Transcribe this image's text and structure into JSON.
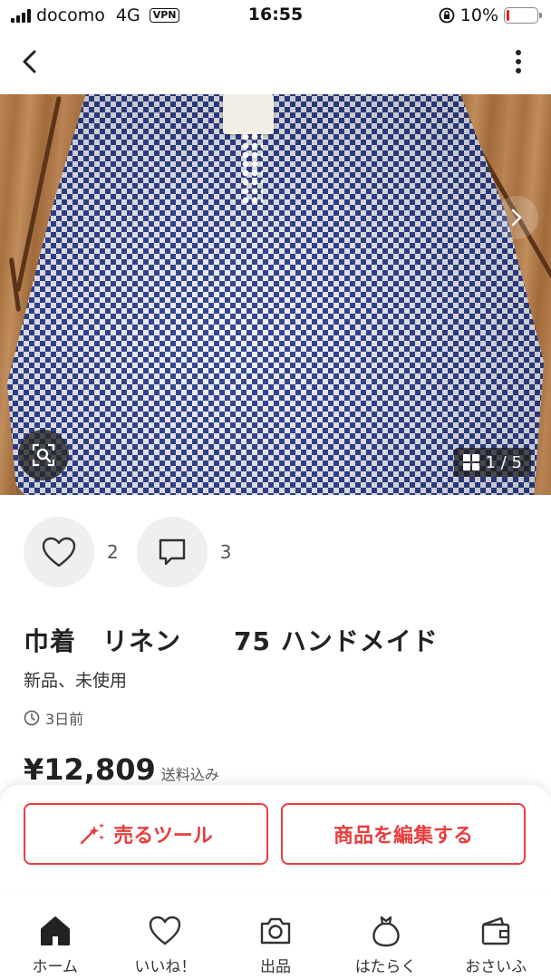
{
  "status_bar": {
    "carrier": "docomo",
    "network": "4G",
    "vpn": "VPN",
    "time": "16:55",
    "battery": "10%",
    "battery_level": 0.1
  },
  "nav": {
    "back_icon": "chevron-left-icon",
    "more_icon": "vertical-dots-icon"
  },
  "photo": {
    "counter": "1 / 5",
    "counter_icon": "grid-icon",
    "search_icon": "image-search-icon",
    "next_icon": "chevron-right-icon"
  },
  "reactions": {
    "likes": "2",
    "comments": "3"
  },
  "item": {
    "title": "巾着　リネン　　75 ハンドメイド",
    "condition": "新品、未使用",
    "posted": "3日前",
    "price": "¥12,809",
    "price_note": "送料込み"
  },
  "actions": {
    "sell_tool": "売るツール",
    "edit_item": "商品を編集する",
    "accent": "#e83e3e"
  },
  "tabs": [
    {
      "label": "ホーム",
      "icon": "home-icon"
    },
    {
      "label": "いいね！",
      "icon": "heart-icon"
    },
    {
      "label": "出品",
      "icon": "camera-icon"
    },
    {
      "label": "はたらく",
      "icon": "money-bag-icon"
    },
    {
      "label": "おさいふ",
      "icon": "wallet-icon"
    }
  ]
}
